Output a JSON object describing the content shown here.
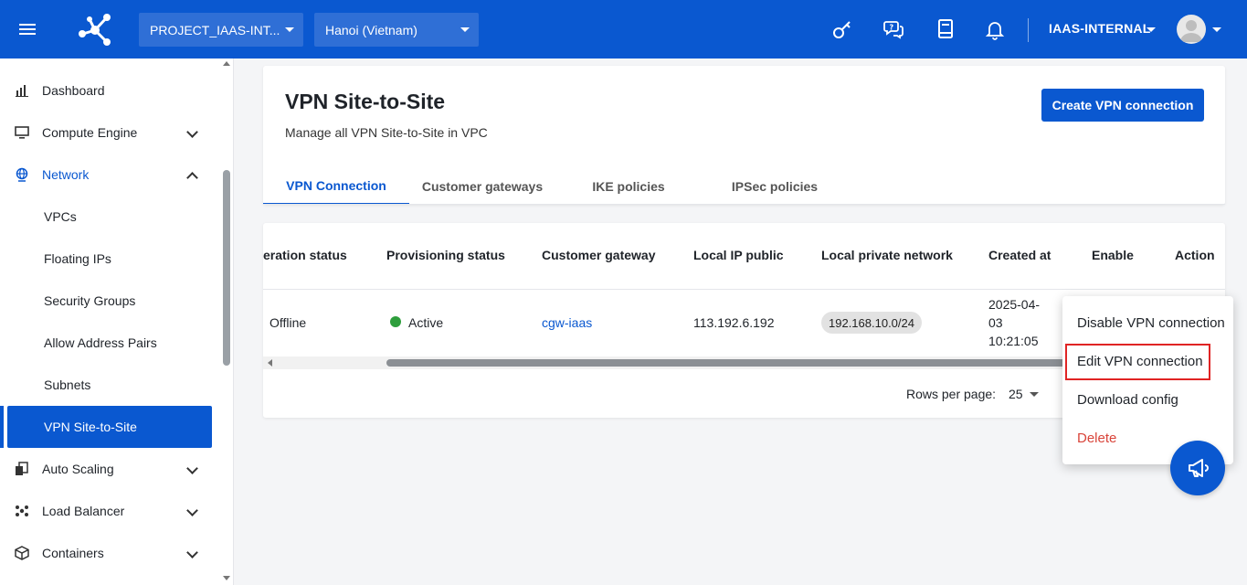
{
  "topbar": {
    "project": "PROJECT_IAAS-INT...",
    "region": "Hanoi (Vietnam)",
    "account": "IAAS-INTERNAL"
  },
  "sidebar": {
    "items": [
      {
        "label": "Dashboard"
      },
      {
        "label": "Compute Engine"
      },
      {
        "label": "Network"
      },
      {
        "label": "VPCs"
      },
      {
        "label": "Floating IPs"
      },
      {
        "label": "Security Groups"
      },
      {
        "label": "Allow Address Pairs"
      },
      {
        "label": "Subnets"
      },
      {
        "label": "VPN Site-to-Site"
      },
      {
        "label": "Auto Scaling"
      },
      {
        "label": "Load Balancer"
      },
      {
        "label": "Containers"
      }
    ]
  },
  "page": {
    "title": "VPN Site-to-Site",
    "subtitle": "Manage all VPN Site-to-Site in VPC",
    "create_button": "Create VPN connection",
    "tabs": [
      {
        "label": "VPN Connection"
      },
      {
        "label": "Customer gateways"
      },
      {
        "label": "IKE policies"
      },
      {
        "label": "IPSec policies"
      }
    ]
  },
  "table": {
    "columns": [
      "eration status",
      "Provisioning status",
      "Customer gateway",
      "Local IP public",
      "Local private network",
      "Created at",
      "Enable",
      "Action"
    ],
    "row": {
      "operation_status": "Offline",
      "provisioning_status": "Active",
      "customer_gateway": "cgw-iaas",
      "local_ip_public": "113.192.6.192",
      "local_private_network": "192.168.10.0/24",
      "created_line1": "2025-04-",
      "created_line2": "03",
      "created_line3": "10:21:05"
    },
    "rows_per_page_label": "Rows per page:",
    "rows_per_page_value": "25"
  },
  "context_menu": {
    "items": [
      "Disable VPN connection",
      "Edit VPN connection",
      "Download config",
      "Delete"
    ]
  },
  "colors": {
    "primary": "#0a58d0",
    "active_status": "#2e9e3c",
    "danger": "#d9443a",
    "highlight": "#e02424"
  }
}
